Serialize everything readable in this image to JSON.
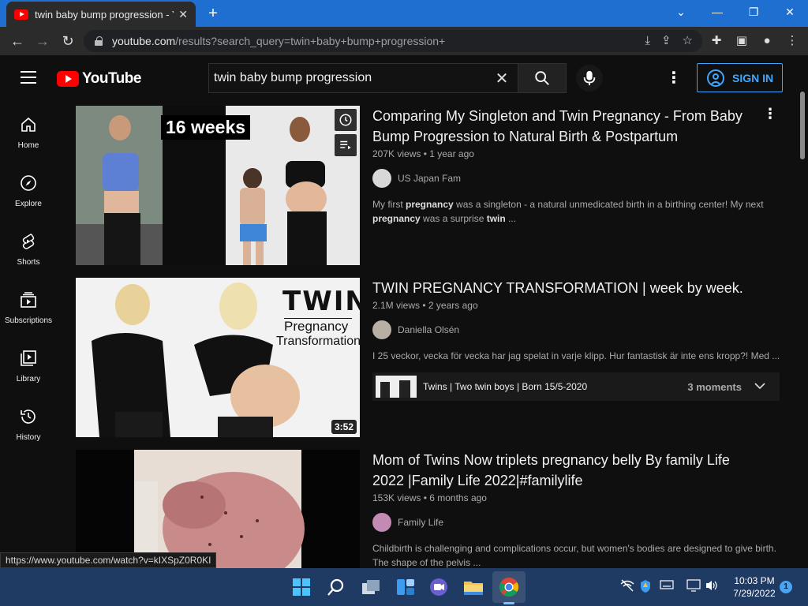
{
  "browser": {
    "tab_title": "twin baby bump progression - Yo",
    "url_host": "youtube.com",
    "url_path": "/results?search_query=twin+baby+bump+progression+",
    "status_url": "https://www.youtube.com/watch?v=kIXSpZ0R0KI"
  },
  "masthead": {
    "logo_text": "YouTube",
    "search_value": "twin baby bump progression",
    "sign_in_label": "SIGN IN"
  },
  "guide": {
    "items": [
      {
        "label": "Home",
        "icon": "home-icon"
      },
      {
        "label": "Explore",
        "icon": "compass-icon"
      },
      {
        "label": "Shorts",
        "icon": "shorts-icon"
      },
      {
        "label": "Subscriptions",
        "icon": "subscriptions-icon"
      },
      {
        "label": "Library",
        "icon": "library-icon"
      },
      {
        "label": "History",
        "icon": "history-icon"
      }
    ]
  },
  "results": [
    {
      "title": "Comparing My Singleton and Twin Pregnancy - From Baby Bump Progression to Natural Birth & Postpartum",
      "views": "207K views",
      "age": "1 year ago",
      "channel": "US Japan Fam",
      "description_parts": [
        "My first ",
        "pregnancy",
        " was a singleton - a natural unmedicated birth in a birthing center! My next ",
        "pregnancy",
        " was a surprise ",
        "twin",
        " ..."
      ],
      "thumb_overlay_text": "16 weeks"
    },
    {
      "title": "TWIN PREGNANCY TRANSFORMATION | week by week.",
      "views": "2.1M views",
      "age": "2 years ago",
      "channel": "Daniella Olsén",
      "description": "I 25 veckor, vecka för vecka har jag spelat in varje klipp. Hur fantastisk är inte ens kropp?! Med ...",
      "duration": "3:52",
      "thumb_overlay_line1": "TWIN",
      "thumb_overlay_line2": "Pregnancy",
      "thumb_overlay_line3": "Transformation",
      "moments_label": "Twins | Two twin boys | Born 15/5-2020",
      "moments_count": "3 moments"
    },
    {
      "title": "Mom of Twins Now triplets pregnancy belly By family Life 2022 |Family Life 2022|#familylife",
      "views": "153K views",
      "age": "6 months ago",
      "channel": "Family Life",
      "description": "Childbirth is challenging and complications occur, but women's bodies are designed to give birth. The shape of the pelvis ..."
    }
  ],
  "taskbar": {
    "time": "10:03 PM",
    "date": "7/29/2022",
    "notification_count": "1"
  }
}
